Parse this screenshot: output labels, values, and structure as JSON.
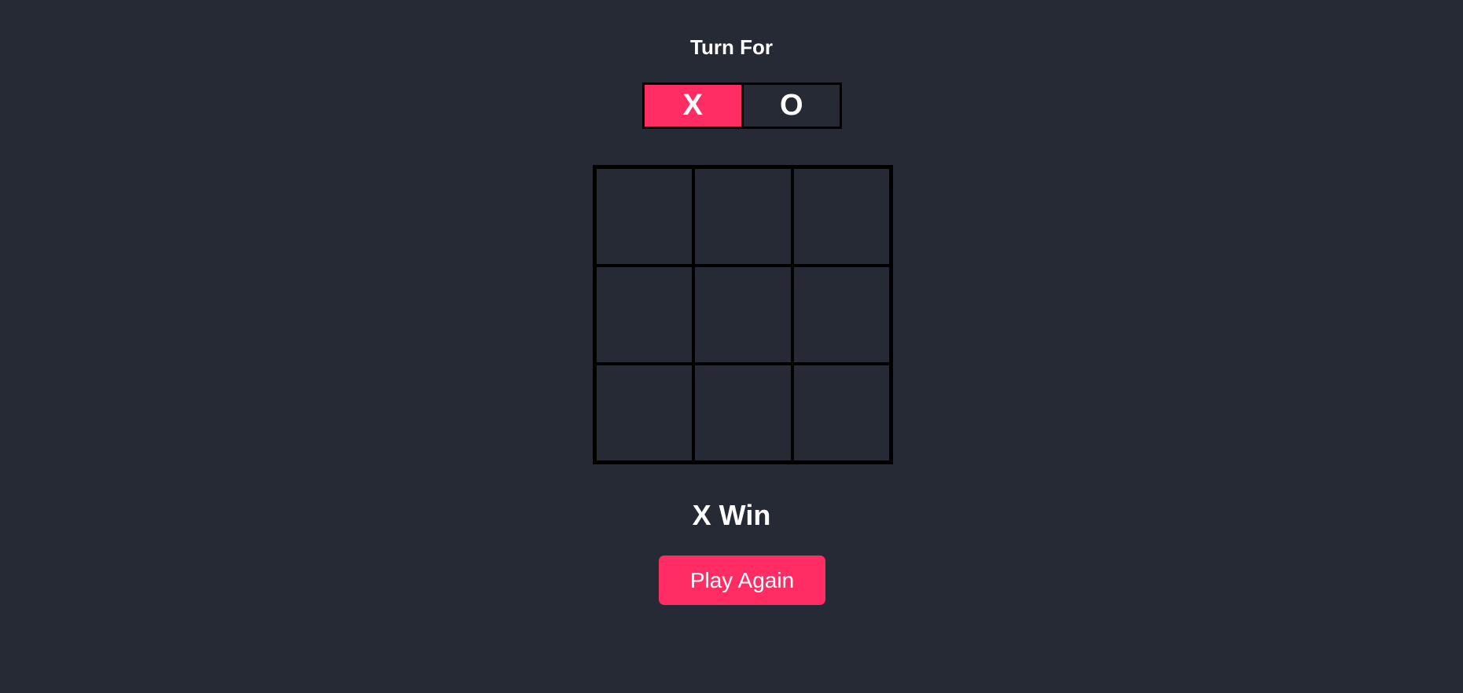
{
  "header": {
    "turn_label": "Turn For"
  },
  "turn_toggle": {
    "options": [
      {
        "label": "X",
        "active": true
      },
      {
        "label": "O",
        "active": false
      }
    ]
  },
  "board": {
    "cells": [
      "",
      "",
      "",
      "",
      "",
      "",
      "",
      "",
      ""
    ]
  },
  "status": {
    "result_text": "X Win"
  },
  "actions": {
    "play_again_label": "Play Again"
  },
  "colors": {
    "background": "#252a35",
    "accent": "#ff2d63",
    "grid_line": "#000000",
    "text": "#ffffff"
  }
}
